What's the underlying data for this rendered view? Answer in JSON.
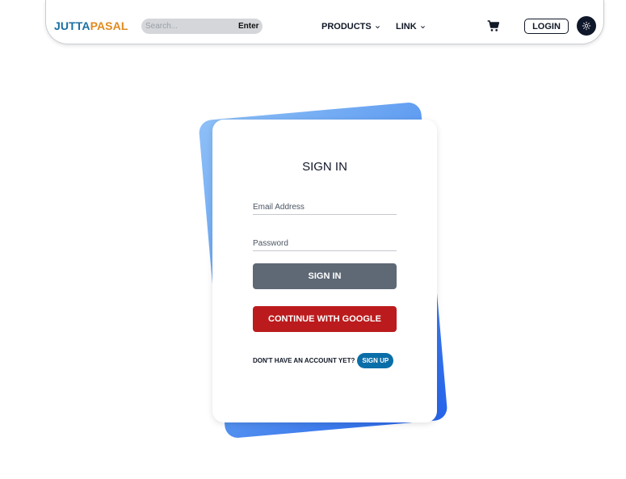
{
  "navbar": {
    "logo_part1": "JUTTA",
    "logo_part2": "PASAL",
    "search_placeholder": "Search...",
    "search_button": "Enter",
    "products_label": "PRODUCTS",
    "link_label": "LINK",
    "cart_icon": "shopping-cart-icon",
    "login_label": "LOGIN",
    "theme_icon": "sun-icon"
  },
  "signin": {
    "title": "SIGN IN",
    "email_placeholder": "Email Address",
    "password_placeholder": "Password",
    "submit_label": "SIGN IN",
    "google_label": "CONTINUE WITH GOOGLE",
    "signup_prompt": "DON'T HAVE AN ACCOUNT YET?",
    "signup_label": "SIGN UP"
  },
  "colors": {
    "logo_blue": "#1b6fa3",
    "logo_orange": "#e08a1e",
    "signin_button": "#5f6875",
    "google_button": "#bb1b1d",
    "signup_button": "#0a6ea8",
    "back_card_light": "#8ec0f7",
    "back_card_dark": "#2563eb"
  }
}
